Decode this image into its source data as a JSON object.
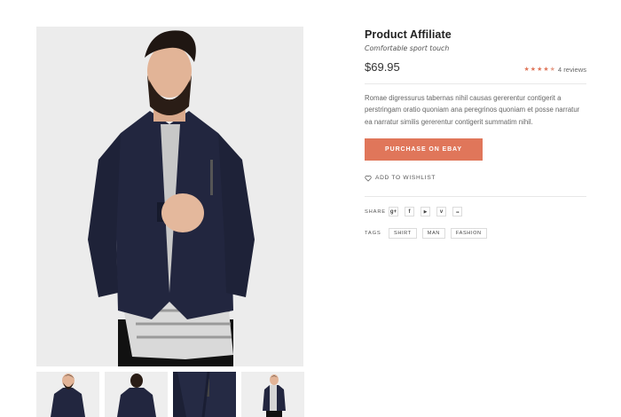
{
  "product": {
    "title": "Product Affiliate",
    "subtitle": "Comfortable sport touch",
    "price": "$69.95",
    "rating": {
      "value": 4.5,
      "max": 5,
      "reviews_label": "4 reviews"
    },
    "description": "Romae digressurus tabernas nihil causas gererentur contigerit a perstringam oratio quoniam ana peregrinos quoniam et posse narratur ea narratur similis gererentur contigerit summatim nihil.",
    "buy_label": "PURCHASE ON EBAY",
    "wishlist_label": "ADD TO WISHLIST"
  },
  "share": {
    "label": "SHARE",
    "icons": [
      {
        "name": "google-plus-icon",
        "glyph": "g+"
      },
      {
        "name": "facebook-icon",
        "glyph": "f"
      },
      {
        "name": "youtube-icon",
        "glyph": "▶"
      },
      {
        "name": "vimeo-icon",
        "glyph": "v"
      },
      {
        "name": "flickr-icon",
        "glyph": "●●"
      }
    ]
  },
  "tags": {
    "label": "TAGS",
    "items": [
      "SHIRT",
      "MAN",
      "FASHION"
    ]
  },
  "colors": {
    "accent": "#e0765a",
    "jacket": "#22263f",
    "background": "#ececec"
  },
  "gallery": {
    "thumbnail_count": 4
  }
}
